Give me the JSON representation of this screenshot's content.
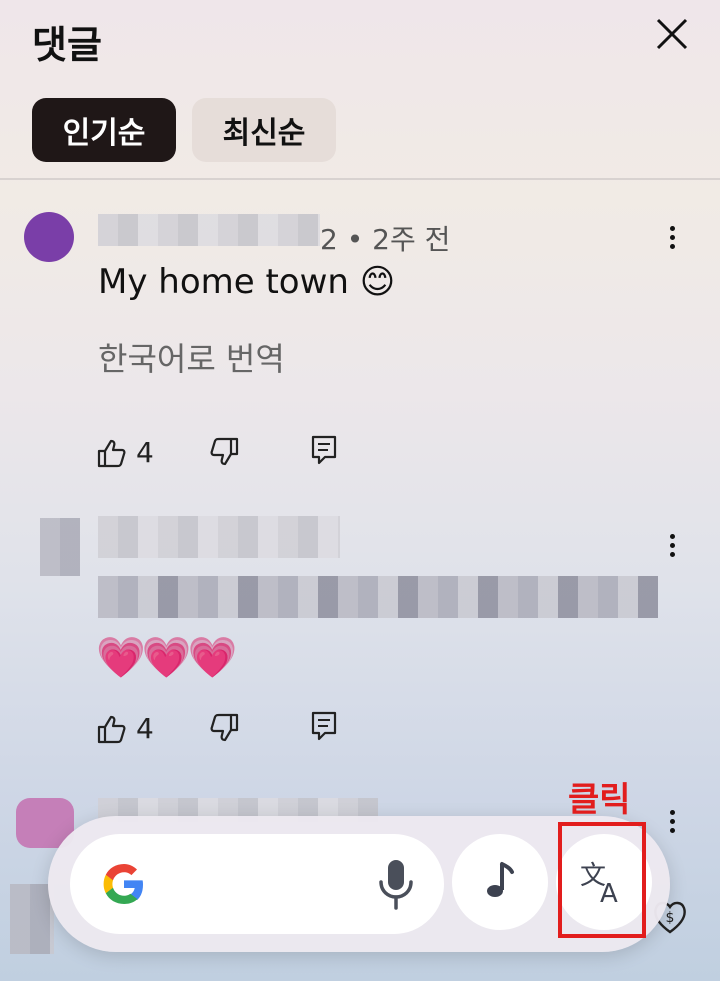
{
  "header": {
    "title": "댓글"
  },
  "sort_tabs": [
    {
      "label": "인기순",
      "active": true
    },
    {
      "label": "최신순",
      "active": false
    }
  ],
  "comments": [
    {
      "meta": "2 • 2주 전",
      "text": "My home town 😊",
      "translate_link": "한국어로 번역",
      "likes": "4"
    },
    {
      "text": "💗💗💗",
      "likes": "4"
    }
  ],
  "overlay": {
    "annotation_label": "클릭",
    "icons": [
      "google-logo",
      "microphone-icon",
      "music-note-icon",
      "translate-icon"
    ]
  },
  "colors": {
    "annotation": "#e21d1d",
    "active_tab": "#1f1717",
    "inactive_tab": "#e6ddd9"
  }
}
